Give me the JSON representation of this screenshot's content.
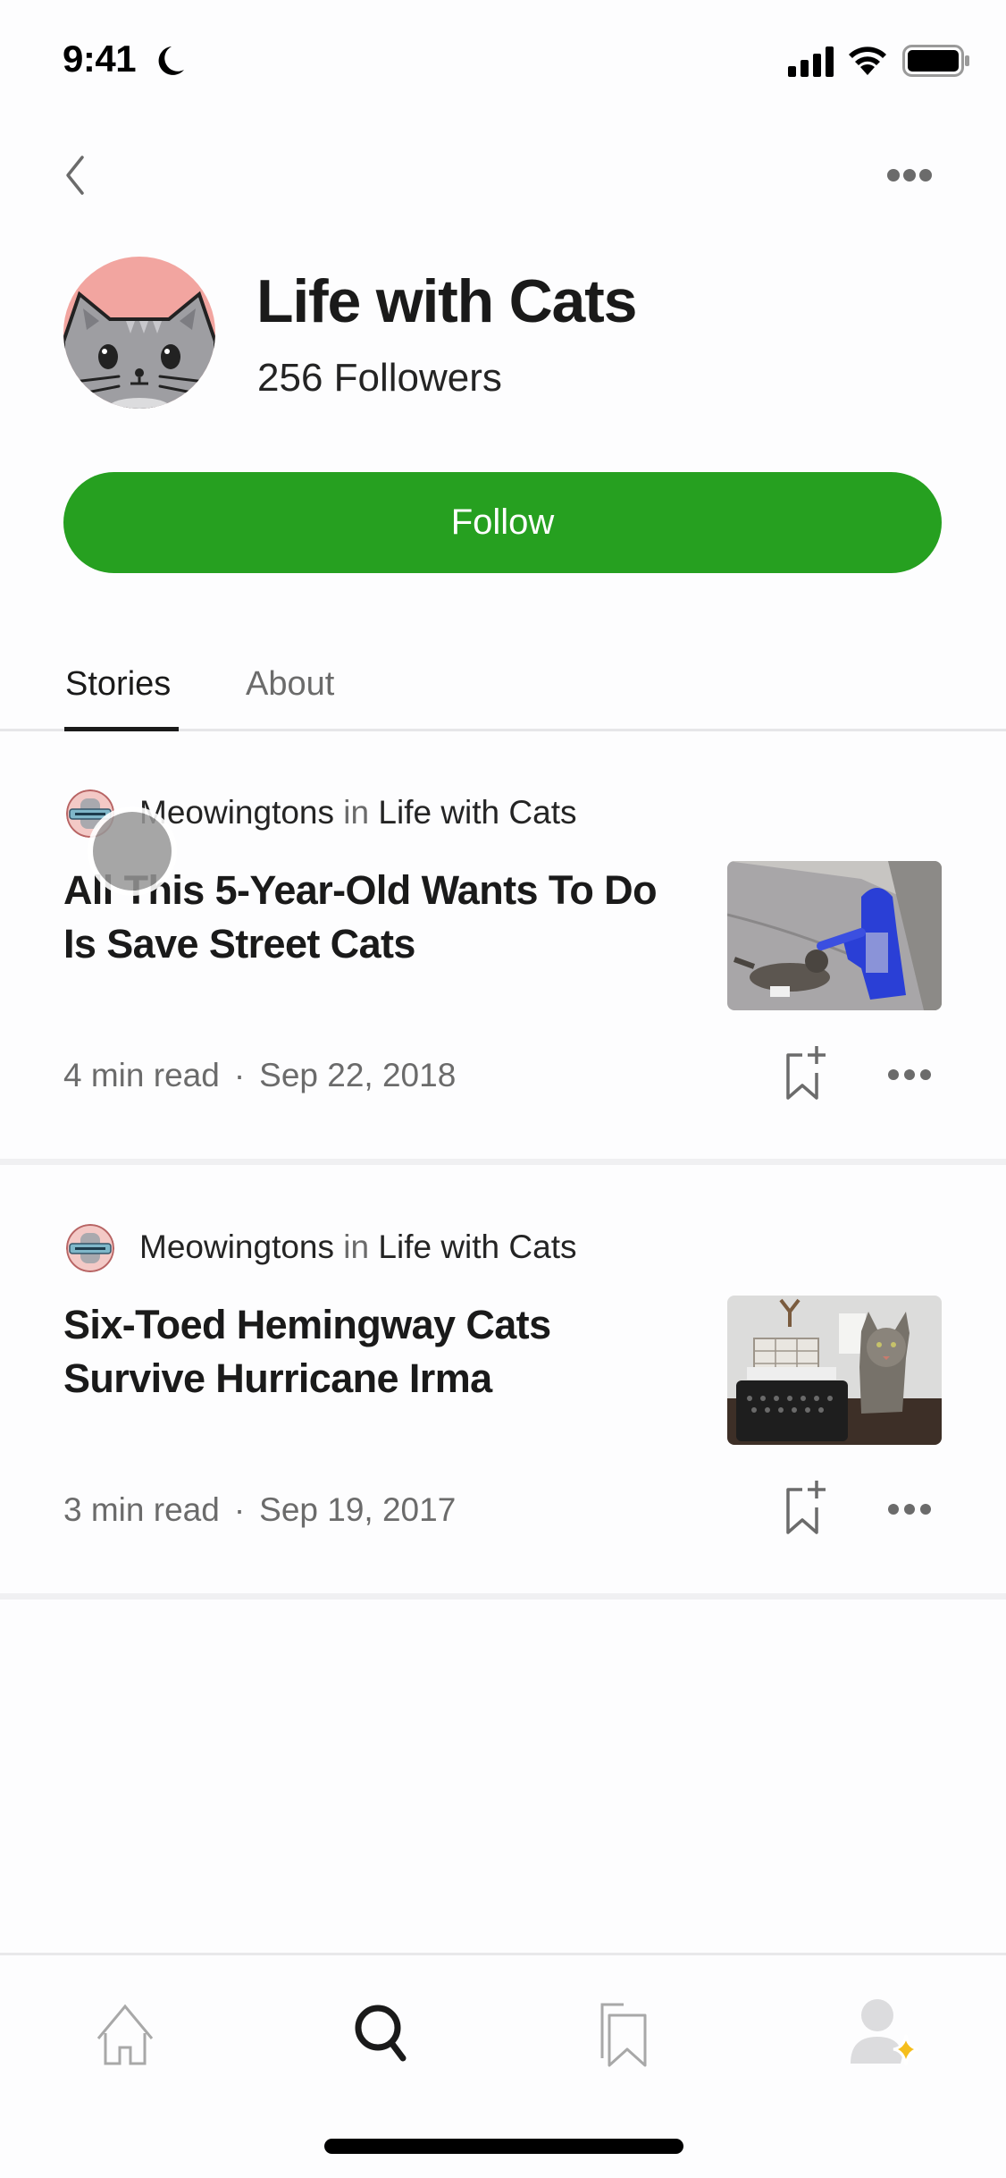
{
  "status_bar": {
    "time": "9:41",
    "icons": [
      "moon-icon",
      "cellular-signal-icon",
      "wifi-icon",
      "battery-icon"
    ]
  },
  "nav": {
    "back_icon": "chevron-left-icon",
    "more_icon": "more-horizontal-icon"
  },
  "publication": {
    "name": "Life with Cats",
    "followers": "256 Followers",
    "avatar_icon": "cat-face-avatar",
    "follow_label": "Follow",
    "accent_color": "#26a020"
  },
  "tabs": [
    {
      "label": "Stories",
      "active": true
    },
    {
      "label": "About",
      "active": false
    }
  ],
  "stories": [
    {
      "author": "Meowingtons",
      "in_word": "in",
      "publication": "Life with Cats",
      "title": "All This 5-Year-Old Wants To Do Is Save Street Cats",
      "read_time": "4  min read",
      "separator": "·",
      "date": "Sep 22, 2018",
      "thumbnail": "child in blue superhero costume petting a street cat"
    },
    {
      "author": "Meowingtons",
      "in_word": "in",
      "publication": "Life with Cats",
      "title": "Six-Toed Hemingway Cats Survive Hurricane Irma",
      "read_time": "3  min read",
      "separator": "·",
      "date": "Sep 19, 2017",
      "thumbnail": "tabby cat standing next to a typewriter"
    }
  ],
  "tabbar": [
    {
      "name": "home",
      "icon": "home-icon",
      "active": false
    },
    {
      "name": "search",
      "icon": "search-icon",
      "active": true
    },
    {
      "name": "bookmarks",
      "icon": "bookmarks-icon",
      "active": false
    },
    {
      "name": "profile",
      "icon": "profile-icon",
      "active": false,
      "badge": "sparkle-icon"
    }
  ]
}
